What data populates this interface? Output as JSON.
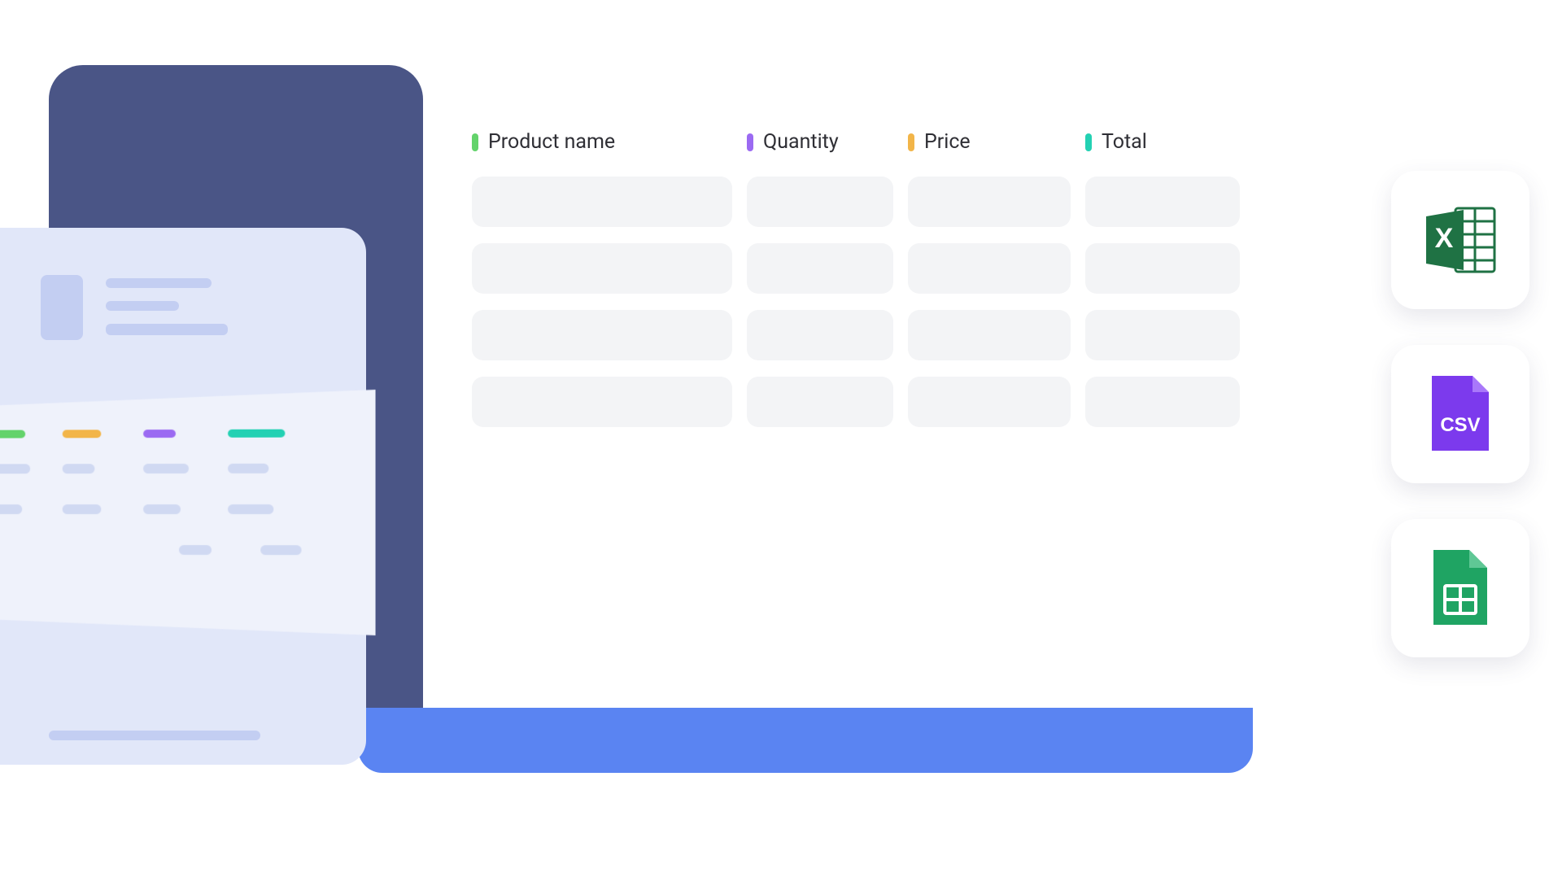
{
  "table": {
    "columns": [
      {
        "label": "Product name",
        "color": "green"
      },
      {
        "label": "Quantity",
        "color": "purple"
      },
      {
        "label": "Price",
        "color": "orange"
      },
      {
        "label": "Total",
        "color": "teal"
      }
    ],
    "row_count": 4
  },
  "exports": [
    {
      "name": "excel"
    },
    {
      "name": "csv"
    },
    {
      "name": "sheets"
    }
  ]
}
